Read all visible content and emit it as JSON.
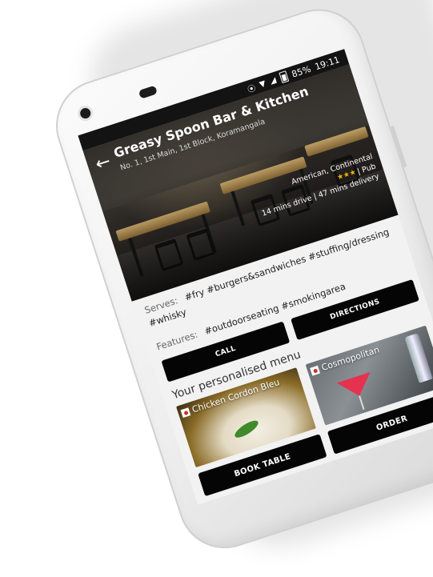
{
  "status_bar": {
    "battery": "85%",
    "time": "19:11",
    "icons": [
      "location-icon",
      "wifi-icon",
      "signal-icon",
      "battery-icon"
    ]
  },
  "restaurant": {
    "name": "Greasy Spoon Bar & Kitchen",
    "address": "No. 1, 1st Main, 1st Block, Koramangala",
    "cuisine": "American, Continental",
    "type": "| Pub",
    "distance": "14 mins drive | 47 mins delivery"
  },
  "details": {
    "serves_label": "Serves:",
    "serves_tags": "#fry  #burgers&sandwiches  #stuffing/dressing  #whisky",
    "features_label": "Features:",
    "features_tags": "#outdoorseating  #smokingarea"
  },
  "actions": {
    "call": "CALL",
    "directions": "DIRECTIONS",
    "book_table": "BOOK TABLE",
    "order": "ORDER"
  },
  "menu": {
    "heading": "Your personalised menu",
    "items": [
      {
        "name": "Chicken Cordon Bleu",
        "veg_mark": "non-veg"
      },
      {
        "name": "Cosmopolitan",
        "veg_mark": "non-veg"
      }
    ]
  },
  "colors": {
    "button_bg": "#050505",
    "screen_bg": "#f2f2f2",
    "non_veg_mark": "#d6282e",
    "rating_star": "#f0b400"
  }
}
